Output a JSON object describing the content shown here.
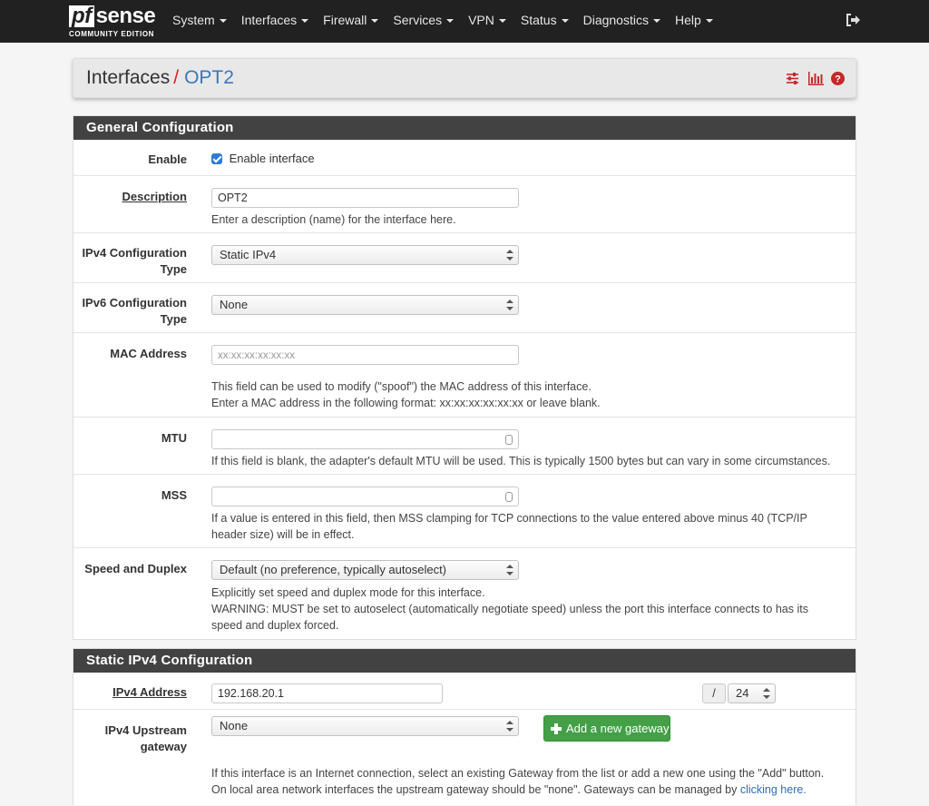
{
  "brand": {
    "logo_pf": "pf",
    "logo_sense": "sense",
    "edition": "COMMUNITY EDITION"
  },
  "nav": {
    "items": [
      "System",
      "Interfaces",
      "Firewall",
      "Services",
      "VPN",
      "Status",
      "Diagnostics",
      "Help"
    ],
    "logout_icon": "logout-icon"
  },
  "breadcrumb": {
    "parent": "Interfaces",
    "separator": "/",
    "current": "OPT2",
    "icons": [
      "sliders-icon",
      "bar-chart-icon",
      "help-icon"
    ]
  },
  "general": {
    "title": "General Configuration",
    "enable": {
      "label": "Enable",
      "checkbox_label": "Enable interface",
      "checked": true
    },
    "description": {
      "label": "Description",
      "value": "OPT2",
      "help": "Enter a description (name) for the interface here."
    },
    "ipv4_type": {
      "label_line1": "IPv4 Configuration",
      "label_line2": "Type",
      "value": "Static IPv4"
    },
    "ipv6_type": {
      "label_line1": "IPv6 Configuration",
      "label_line2": "Type",
      "value": "None"
    },
    "mac": {
      "label": "MAC Address",
      "placeholder": "xx:xx:xx:xx:xx:xx",
      "help_line1": "This field can be used to modify (\"spoof\") the MAC address of this interface.",
      "help_line2": "Enter a MAC address in the following format: xx:xx:xx:xx:xx:xx or leave blank."
    },
    "mtu": {
      "label": "MTU",
      "value": "",
      "help": "If this field is blank, the adapter's default MTU will be used. This is typically 1500 bytes but can vary in some circumstances."
    },
    "mss": {
      "label": "MSS",
      "value": "",
      "help_line1": "If a value is entered in this field, then MSS clamping for TCP connections to the value entered above minus 40 (TCP/IP",
      "help_line2": "header size) will be in effect."
    },
    "speed": {
      "label": "Speed and Duplex",
      "value": "Default (no preference, typically autoselect)",
      "help_line1": "Explicitly set speed and duplex mode for this interface.",
      "help_line2": "WARNING: MUST be set to autoselect (automatically negotiate speed) unless the port this interface connects to has its",
      "help_line3": "speed and duplex forced."
    }
  },
  "static_ipv4": {
    "title": "Static IPv4 Configuration",
    "address": {
      "label": "IPv4 Address",
      "value": "192.168.20.1",
      "slash": "/",
      "cidr": "24"
    },
    "gateway": {
      "label_line1": "IPv4 Upstream",
      "label_line2": "gateway",
      "value": "None",
      "add_button": "Add a new gateway",
      "help_line1": "If this interface is an Internet connection, select an existing Gateway from the list or add a new one using the \"Add\" button.",
      "help_line2_pre": "On local area network interfaces the upstream gateway should be \"none\". Gateways can be managed by ",
      "help_link": "clicking here."
    }
  }
}
